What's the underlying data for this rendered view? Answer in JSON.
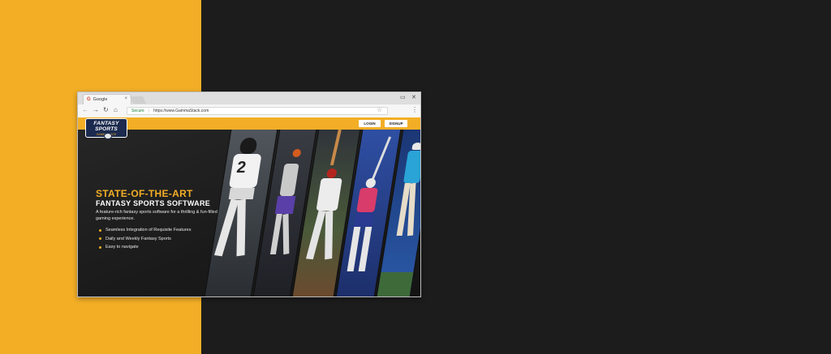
{
  "browser": {
    "tab_title": "Google",
    "tab_close": "×",
    "window_minimize": "▭",
    "window_close": "✕",
    "secure_label": "Secure",
    "url": "https://www.GammaStack.com"
  },
  "site": {
    "logo": {
      "line1": "FANTASY SPORTS",
      "line2": "GAMMASTACK"
    },
    "nav": {
      "login": "LOGIN",
      "signup": "SIGNUP"
    },
    "hero": {
      "title_line1": "STATE-OF-THE-ART",
      "title_line2": "FANTASY SPORTS SOFTWARE",
      "description": "A feature-rich fantasy sports software for a thrilling & fun-filled gaming experience.",
      "features": [
        "Seamless Integration of Requisite Features",
        "Daily and Weekly Fantasy Sports",
        "Easy to navigate"
      ]
    }
  },
  "colors": {
    "accent": "#f3ae26",
    "dark": "#1c1c1c"
  },
  "panels": [
    {
      "sport": "american-football",
      "bg": "#3a3f45"
    },
    {
      "sport": "basketball",
      "bg": "#2b2d33"
    },
    {
      "sport": "baseball",
      "bg": "#4a5a3a"
    },
    {
      "sport": "hockey",
      "bg": "#2c3f7a"
    },
    {
      "sport": "golf",
      "bg": "#1f3b78"
    }
  ]
}
